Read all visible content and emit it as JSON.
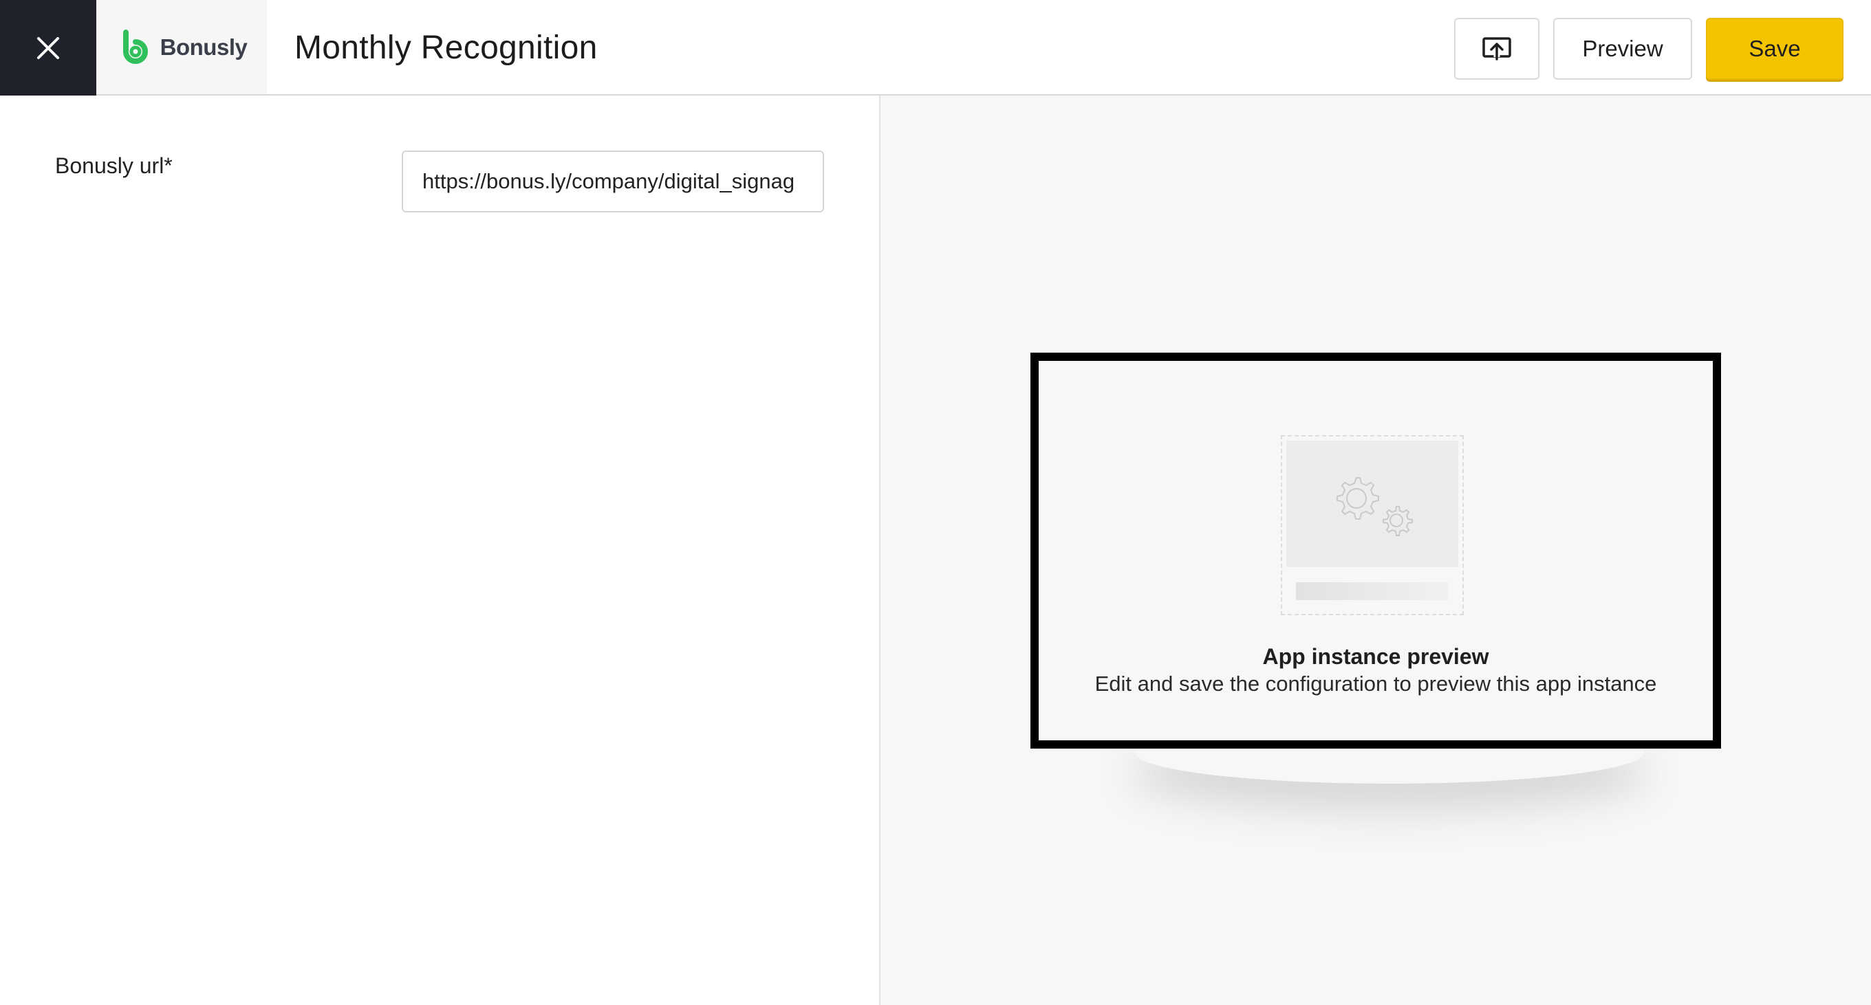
{
  "header": {
    "title": "Monthly Recognition",
    "logo_text": "Bonusly",
    "close_icon": "close-icon",
    "cast_icon": "cast-screen-icon",
    "preview_label": "Preview",
    "save_label": "Save",
    "save_color": "#f5c400"
  },
  "form": {
    "url_label": "Bonusly url*",
    "url_value": "https://bonus.ly/company/digital_signag"
  },
  "preview": {
    "title": "App instance preview",
    "subtitle": "Edit and save the configuration to preview this app instance",
    "placeholder_icon": "gears-icon"
  },
  "colors": {
    "brand_green": "#2fbf5b",
    "close_bg": "#1f222a"
  }
}
